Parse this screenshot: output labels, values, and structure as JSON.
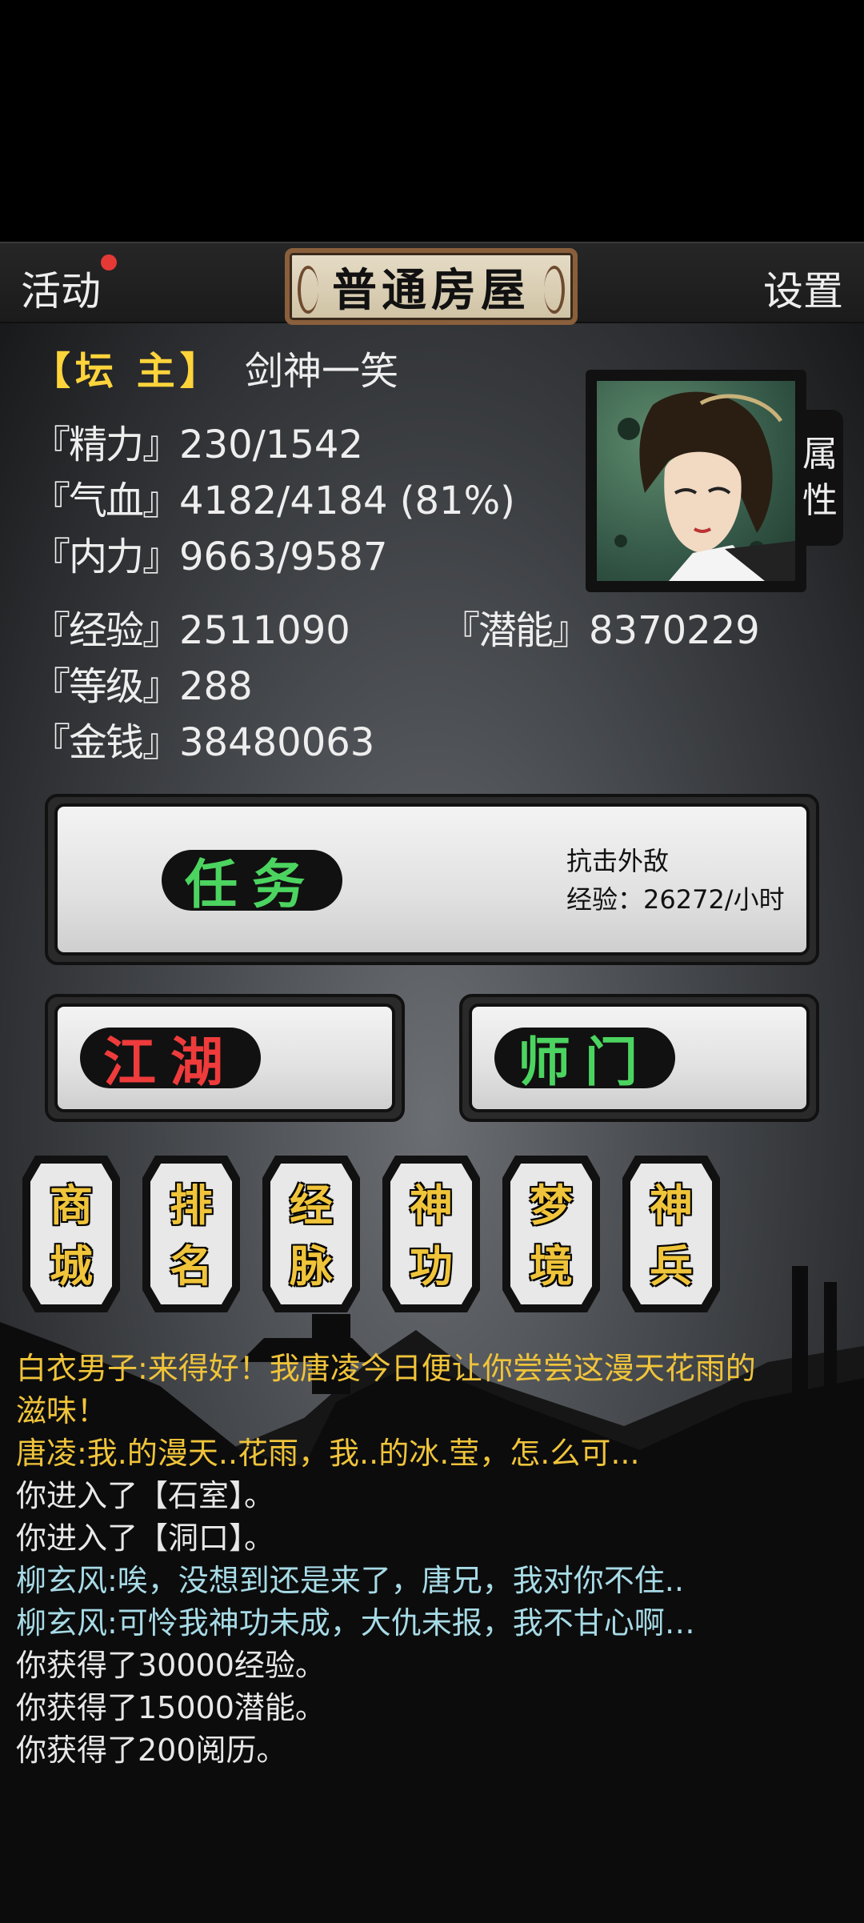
{
  "topbar": {
    "activity_label": "活动",
    "title": "普通房屋",
    "settings_label": "设置"
  },
  "player": {
    "rank": "【坛 主】",
    "name": "剑神一笑",
    "attributes_tab": [
      "属",
      "性"
    ]
  },
  "stats": {
    "energy": {
      "key": "『精力』",
      "value": "230/1542"
    },
    "hp": {
      "key": "『气血』",
      "value": "4182/4184 (81%)"
    },
    "inner": {
      "key": "『内力』",
      "value": "9663/9587"
    },
    "exp": {
      "key": "『经验』",
      "value": "2511090"
    },
    "potential": {
      "key": "『潜能』",
      "value": "8370229"
    },
    "level": {
      "key": "『等级』",
      "value": "288"
    },
    "money": {
      "key": "『金钱』",
      "value": "38480063"
    }
  },
  "buttons": {
    "task": {
      "label": "任务",
      "desc_line1": "抗击外敌",
      "desc_line2": "经验：26272/小时"
    },
    "jianghu": {
      "label": "江湖"
    },
    "shimen": {
      "label": "师门"
    }
  },
  "hex_buttons": [
    {
      "top": "商",
      "bottom": "城"
    },
    {
      "top": "排",
      "bottom": "名"
    },
    {
      "top": "经",
      "bottom": "脉"
    },
    {
      "top": "神",
      "bottom": "功"
    },
    {
      "top": "梦",
      "bottom": "境"
    },
    {
      "top": "神",
      "bottom": "兵"
    }
  ],
  "log": [
    {
      "text": "白衣男子:来得好！我唐凌今日便让你尝尝这漫天花雨的",
      "color": "yellow"
    },
    {
      "text": "滋味！",
      "color": "yellow"
    },
    {
      "text": "唐凌:我.的漫天..花雨，我..的冰.莹，怎.么可...",
      "color": "yellow"
    },
    {
      "text": "你进入了【石室】。",
      "color": "white"
    },
    {
      "text": "你进入了【洞口】。",
      "color": "white"
    },
    {
      "text": "柳玄风:唉，没想到还是来了，唐兄，我对你不住..",
      "color": "cyan"
    },
    {
      "text": "柳玄风:可怜我神功未成，大仇未报，我不甘心啊…",
      "color": "cyan"
    },
    {
      "text": "你获得了30000经验。",
      "color": "white"
    },
    {
      "text": "你获得了15000潜能。",
      "color": "white"
    },
    {
      "text": "你获得了200阅历。",
      "color": "white"
    }
  ],
  "colors": {
    "notification_dot": "#e53935",
    "rank": "#ffd43b",
    "green_label": "#4cd460",
    "red_label": "#ef3b3b",
    "gold": "#f0c43a"
  }
}
